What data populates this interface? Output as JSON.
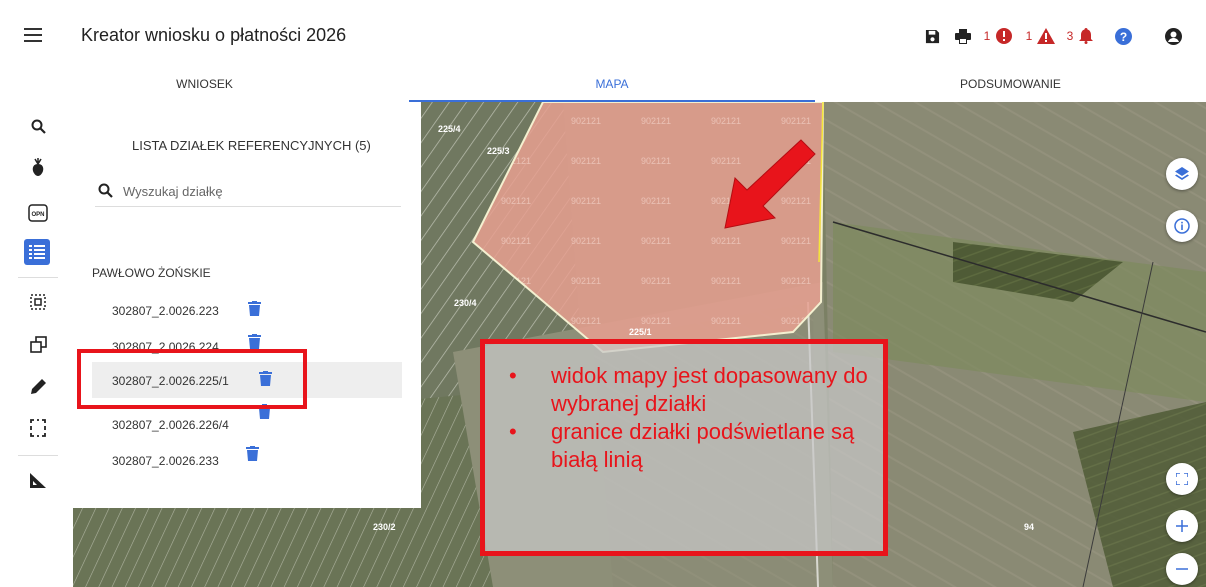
{
  "header": {
    "title": "Kreator wniosku o płatności 2026",
    "counts": {
      "errors": "1",
      "warnings": "1",
      "notifications": "3"
    }
  },
  "tabs": [
    {
      "label": "WNIOSEK"
    },
    {
      "label": "MAPA"
    },
    {
      "label": "PODSUMOWANIE"
    }
  ],
  "active_tab": "MAPA",
  "panel": {
    "title": "LISTA DZIAŁEK REFERENCYJNYCH (5)",
    "search_placeholder": "Wyszukaj działkę",
    "group_label": "PAWŁOWO ŻOŃSKIE",
    "parcels": [
      {
        "label": "302807_2.0026.223"
      },
      {
        "label": "302807_2.0026.224"
      },
      {
        "label": "302807_2.0026.225/1"
      },
      {
        "label": "302807_2.0026.226/4"
      },
      {
        "label": "302807_2.0026.233"
      }
    ],
    "selected_parcel": "302807_2.0026.225/1"
  },
  "map": {
    "labels": {
      "l1": "225/4",
      "l2": "225/3",
      "l3": "230/4",
      "l4": "225/1",
      "l5": "230/2",
      "l6": "94"
    },
    "watermark": "902121",
    "highlight_color": "#e8a090"
  },
  "callout": {
    "items": [
      "widok mapy jest dopasowany do wybranej działki",
      "granice działki podświetlane są białą linią"
    ],
    "color": "#e8141b"
  },
  "rail_icons": [
    "search-icon",
    "crop-icon",
    "opn-icon",
    "list-icon",
    "select-area-icon",
    "copy-shape-icon",
    "pencil-icon",
    "rectangle-select-icon",
    "ruler-icon"
  ],
  "colors": {
    "accent": "#3a6fd8",
    "danger": "#c62828",
    "annotation": "#e8141b"
  }
}
